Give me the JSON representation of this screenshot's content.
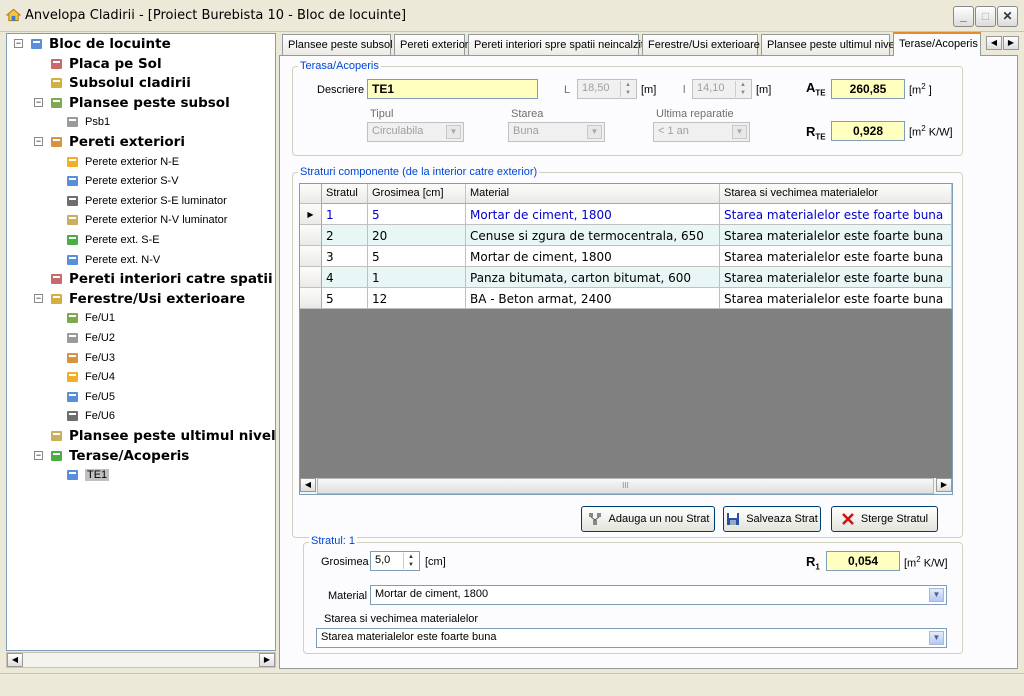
{
  "window": {
    "title": "Anvelopa Cladirii - [Proiect Burebista 10 - Bloc de locuinte]"
  },
  "tree": {
    "root": "Bloc de locuinte",
    "items": [
      {
        "label": "Placa pe Sol",
        "level": 1
      },
      {
        "label": "Subsolul cladirii",
        "level": 1
      },
      {
        "label": "Plansee peste subsol",
        "level": 1
      },
      {
        "label": "Psb1",
        "level": 2
      },
      {
        "label": "Pereti exteriori",
        "level": 1
      },
      {
        "label": "Perete exterior N-E",
        "level": 2
      },
      {
        "label": "Perete exterior S-V",
        "level": 2
      },
      {
        "label": "Perete exterior S-E luminator",
        "level": 2
      },
      {
        "label": "Perete exterior  N-V luminator",
        "level": 2
      },
      {
        "label": "Perete ext. S-E",
        "level": 2
      },
      {
        "label": "Perete ext. N-V",
        "level": 2
      },
      {
        "label": "Pereti interiori catre spatii neincalzite",
        "level": 1
      },
      {
        "label": "Ferestre/Usi exterioare",
        "level": 1
      },
      {
        "label": "Fe/U1",
        "level": 2
      },
      {
        "label": "Fe/U2",
        "level": 2
      },
      {
        "label": "Fe/U3",
        "level": 2
      },
      {
        "label": "Fe/U4",
        "level": 2
      },
      {
        "label": "Fe/U5",
        "level": 2
      },
      {
        "label": "Fe/U6",
        "level": 2
      },
      {
        "label": "Plansee peste ultimul nivel",
        "level": 1
      },
      {
        "label": "Terase/Acoperis",
        "level": 1
      },
      {
        "label": "TE1",
        "level": 2
      }
    ]
  },
  "tabs": [
    "Plansee peste subsol",
    "Pereti exteriori",
    "Pereti interiori spre spatii neincalzite",
    "Ferestre/Usi exterioare",
    "Plansee peste ultimul nivel",
    "Terase/Acoperis"
  ],
  "terasa": {
    "group_label": "Terasa/Acoperis",
    "descriere_label": "Descriere",
    "descriere_value": "TE1",
    "L_label": "L",
    "L_value": "18,50",
    "L_unit": "[m]",
    "l_label": "l",
    "l_value": "14,10",
    "l_unit": "[m]",
    "ate_label_main": "A",
    "ate_label_sub": "TE",
    "ate_value": "260,85",
    "ate_unit_pre": "[m",
    "ate_unit_sup": "2",
    "ate_unit_post": " ]",
    "tipul_label": "Tipul",
    "tipul_value": "Circulabila",
    "starea_label": "Starea",
    "starea_value": "Buna",
    "ultima_label": "Ultima reparatie",
    "ultima_value": "< 1 an",
    "rte_label_main": "R",
    "rte_label_sub": "TE",
    "rte_value": "0,928",
    "rte_unit_pre": "[m",
    "rte_unit_sup": "2",
    "rte_unit_post": " K/W]"
  },
  "straturi": {
    "group_label": "Straturi componente (de la interior catre exterior)",
    "columns": [
      "Stratul",
      "Grosimea [cm]",
      "Material",
      "Starea si vechimea materialelor"
    ],
    "rows": [
      [
        "1",
        "5",
        "Mortar de ciment, 1800",
        "Starea materialelor este foarte buna"
      ],
      [
        "2",
        "20",
        "Cenuse si zgura de termocentrala, 650",
        "Starea materialelor este foarte buna"
      ],
      [
        "3",
        "5",
        "Mortar de ciment, 1800",
        "Starea materialelor este foarte buna"
      ],
      [
        "4",
        "1",
        "Panza bitumata, carton bitumat, 600",
        "Starea materialelor este foarte buna"
      ],
      [
        "5",
        "12",
        "BA - Beton armat, 2400",
        "Starea materialelor este foarte buna"
      ]
    ],
    "scroll_mid": "III"
  },
  "buttons": {
    "add": "Adauga un nou Strat",
    "save": "Salveaza Strat",
    "delete": "Sterge Stratul"
  },
  "stratul": {
    "group_label": "Stratul: 1",
    "grosimea_label": "Grosimea",
    "grosimea_value": "5,0",
    "grosimea_unit": "[cm]",
    "r1_main": "R",
    "r1_sub": "1",
    "r1_value": "0,054",
    "r1_unit_pre": "[m",
    "r1_unit_sup": "2",
    "r1_unit_post": " K/W]",
    "material_label": "Material",
    "material_value": "Mortar de ciment, 1800",
    "starea_label": "Starea si vechimea materialelor",
    "starea_value": "Starea materialelor este foarte buna"
  },
  "colors": {
    "accent_tab": "#e68b2c",
    "selected_text": "#0000cc",
    "input_highlight": "#ffffc0",
    "group_label": "#0046d5"
  }
}
